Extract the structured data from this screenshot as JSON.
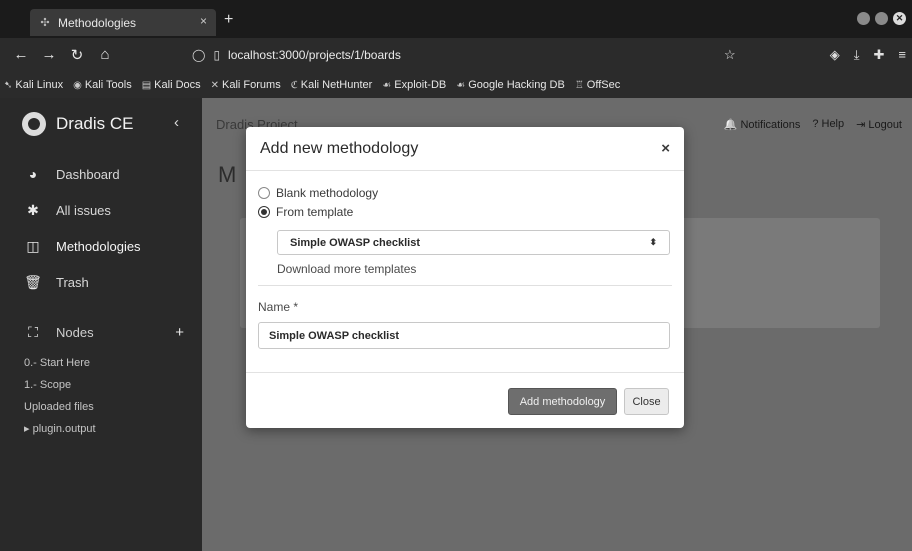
{
  "browser": {
    "tab_title": "Methodologies",
    "tab_close": "×",
    "new_tab": "+",
    "url": "localhost:3000/projects/1/boards",
    "bookmarks": [
      {
        "label": "Kali Linux",
        "icon": "kali-icon"
      },
      {
        "label": "Kali Tools",
        "icon": "kali-tools-icon"
      },
      {
        "label": "Kali Docs",
        "icon": "docs-icon"
      },
      {
        "label": "Kali Forums",
        "icon": "forums-icon"
      },
      {
        "label": "Kali NetHunter",
        "icon": "nethunter-icon"
      },
      {
        "label": "Exploit-DB",
        "icon": "exploit-icon"
      },
      {
        "label": "Google Hacking DB",
        "icon": "ghdb-icon"
      },
      {
        "label": "OffSec",
        "icon": "offsec-icon"
      }
    ]
  },
  "sidebar": {
    "brand": "Dradis CE",
    "collapse": "‹",
    "items": [
      {
        "label": "Dashboard",
        "icon": "dashboard-icon"
      },
      {
        "label": "All issues",
        "icon": "bug-icon"
      },
      {
        "label": "Methodologies",
        "icon": "board-icon"
      },
      {
        "label": "Trash",
        "icon": "trash-icon"
      }
    ],
    "nodes": {
      "label": "Nodes",
      "add": "+",
      "items": [
        "0.- Start Here",
        "1.- Scope",
        "Uploaded files",
        "▸ plugin.output"
      ]
    }
  },
  "main": {
    "project_nav": "Dradis Project",
    "heading": "M",
    "topnav_right": [
      {
        "label": "Notifications",
        "icon": "bell-icon"
      },
      {
        "label": "Help",
        "icon": "help-icon"
      },
      {
        "label": "Logout",
        "icon": "logout-icon"
      }
    ]
  },
  "modal": {
    "title": "Add new methodology",
    "close": "×",
    "option_blank": "Blank methodology",
    "option_template": "From template",
    "selected_template": "Simple OWASP checklist",
    "download_link": "Download more templates",
    "name_label": "Name *",
    "name_value": "Simple OWASP checklist",
    "submit": "Add methodology",
    "close_button": "Close"
  }
}
